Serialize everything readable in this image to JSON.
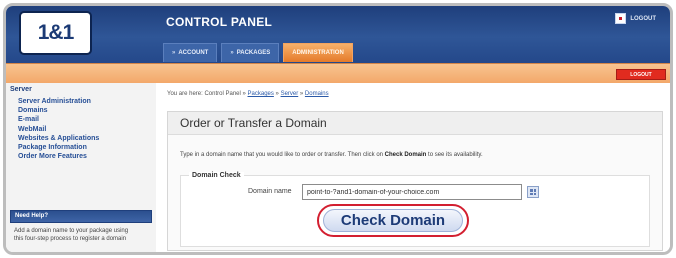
{
  "header": {
    "logo_text": "1&1",
    "app_title": "CONTROL PANEL",
    "logout_label": "LOGOUT",
    "tabs": [
      {
        "label": "ACCOUNT",
        "active": false
      },
      {
        "label": "PACKAGES",
        "active": false
      },
      {
        "label": "ADMINISTRATION",
        "active": true
      }
    ]
  },
  "orange_bar": {
    "button_label": "LOGOUT"
  },
  "sidebar": {
    "group_title": "Server",
    "items": [
      "Server Administration",
      "Domains",
      "E-mail",
      "WebMail",
      "Websites & Applications",
      "Package Information",
      "Order More Features"
    ],
    "help_title": "Need Help?",
    "help_text": "Add a domain name to your package using this four-step process to register a domain"
  },
  "breadcrumb": {
    "prefix": "You are here: Control Panel",
    "links": [
      "Packages",
      "Server",
      "Domains"
    ],
    "separator": "»"
  },
  "panel": {
    "title": "Order or Transfer a Domain",
    "description_before": "Type in a domain name that you would like to order or transfer. Then click on",
    "description_bold": "Check Domain",
    "description_after": "to see its availability.",
    "section_title": "Domain Check",
    "field_label": "Domain name",
    "domain_value": "point-to-?and1-domain-of-your-choice.com",
    "check_button": "Check Domain"
  },
  "colors": {
    "header_blue": "#2f5697",
    "orange_bar": "#f3a86a",
    "highlight_red": "#d31f30",
    "button_text": "#1d3b77"
  }
}
